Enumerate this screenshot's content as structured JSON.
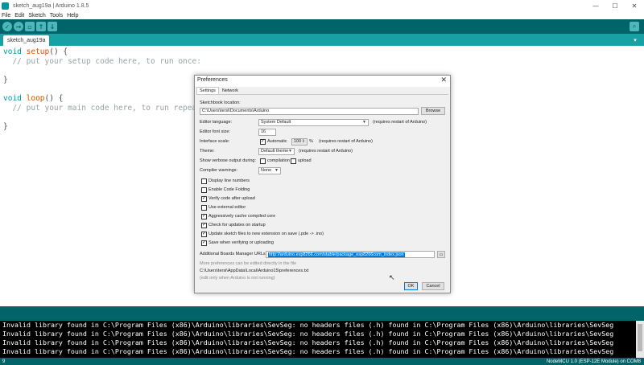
{
  "window": {
    "title": "sketch_aug19a | Arduino 1.8.5",
    "controls": [
      "—",
      "☐",
      "✕"
    ]
  },
  "menu": [
    "File",
    "Edit",
    "Sketch",
    "Tools",
    "Help"
  ],
  "tab": {
    "name": "sketch_aug19a"
  },
  "editor": {
    "lines": [
      {
        "kw": "void",
        "fn": "setup",
        "rest": "() {"
      },
      {
        "comment": "  // put your setup code here, to run once:"
      },
      {
        "plain": "}"
      },
      {
        "kw": "void",
        "fn": "loop",
        "rest": "() {"
      },
      {
        "comment": "  // put your main code here, to run repeatedly:"
      },
      {
        "plain": "}"
      }
    ]
  },
  "console": {
    "lines": [
      "Invalid library found in C:\\Program Files (x86)\\Arduino\\libraries\\SevSeg: no headers files (.h) found in C:\\Program Files (x86)\\Arduino\\libraries\\SevSeg",
      "Invalid library found in C:\\Program Files (x86)\\Arduino\\libraries\\SevSeg: no headers files (.h) found in C:\\Program Files (x86)\\Arduino\\libraries\\SevSeg",
      "Invalid library found in C:\\Program Files (x86)\\Arduino\\libraries\\SevSeg: no headers files (.h) found in C:\\Program Files (x86)\\Arduino\\libraries\\SevSeg",
      "Invalid library found in C:\\Program Files (x86)\\Arduino\\libraries\\SevSeg: no headers files (.h) found in C:\\Program Files (x86)\\Arduino\\libraries\\SevSeg"
    ]
  },
  "status": {
    "line": "9",
    "board": "NodeMCU 1.0 (ESP-12E Module) on COM8"
  },
  "preferences": {
    "title": "Preferences",
    "tabs": [
      "Settings",
      "Network"
    ],
    "sketchbook_label": "Sketchbook location:",
    "sketchbook_value": "C:\\Users\\tersi\\Documents\\Arduino",
    "browse_label": "Browse",
    "language_label": "Editor language:",
    "language_value": "System Default",
    "language_note": "(requires restart of Arduino)",
    "font_size_label": "Editor font size:",
    "font_size_value": "16",
    "scale_label": "Interface scale:",
    "scale_auto_label": "Automatic",
    "scale_value": "100",
    "scale_unit": "%",
    "scale_note": "(requires restart of Arduino)",
    "theme_label": "Theme:",
    "theme_value": "Default theme",
    "theme_note": "(requires restart of Arduino)",
    "verbose_label": "Show verbose output during:",
    "verbose_compilation": "compilation",
    "verbose_upload": "upload",
    "warnings_label": "Compiler warnings:",
    "warnings_value": "None",
    "checkboxes": [
      {
        "label": "Display line numbers",
        "checked": false
      },
      {
        "label": "Enable Code Folding",
        "checked": false
      },
      {
        "label": "Verify code after upload",
        "checked": true
      },
      {
        "label": "Use external editor",
        "checked": false
      },
      {
        "label": "Aggressively cache compiled core",
        "checked": true
      },
      {
        "label": "Check for updates on startup",
        "checked": true
      },
      {
        "label": "Update sketch files to new extension on save (.pde -> .ino)",
        "checked": true
      },
      {
        "label": "Save when verifying or uploading",
        "checked": true
      }
    ],
    "boards_url_label": "Additional Boards Manager URLs:",
    "boards_url_value": "http://arduino.esp8266.com/stable/package_esp8266com_index.json",
    "more_prefs_text": "More preferences can be edited directly in the file",
    "prefs_path": "C:\\Users\\tersi\\AppData\\Local\\Arduino15\\preferences.txt",
    "edit_note": "(edit only when Arduino is not running)",
    "ok_label": "OK",
    "cancel_label": "Cancel"
  },
  "colors": {
    "toolbar": "#006468",
    "tabstrip": "#17a1a5",
    "keyword": "#00979c",
    "function": "#d35400",
    "comment": "#95a5a6",
    "selection": "#0078d7"
  }
}
